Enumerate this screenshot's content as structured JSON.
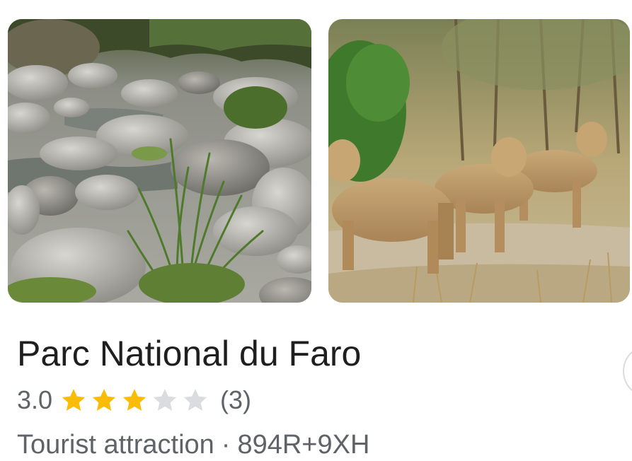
{
  "place": {
    "name": "Parc National du Faro",
    "rating_value": "3.0",
    "rating": 3,
    "rating_max": 5,
    "review_count": "(3)",
    "category": "Tourist attraction",
    "separator": "·",
    "plus_code": "894R+9XH"
  },
  "photos": [
    {
      "id": "rocks",
      "subject": "rocky riverbed with grass"
    },
    {
      "id": "lions",
      "subject": "lionesses in dry bush"
    }
  ],
  "icons": {
    "star_filled": "star-filled-icon",
    "star_empty": "star-empty-icon"
  },
  "colors": {
    "star_filled": "#fbbc04",
    "star_empty": "#dadce0",
    "title_text": "#1f1f1f",
    "secondary_text": "#5f6368"
  }
}
